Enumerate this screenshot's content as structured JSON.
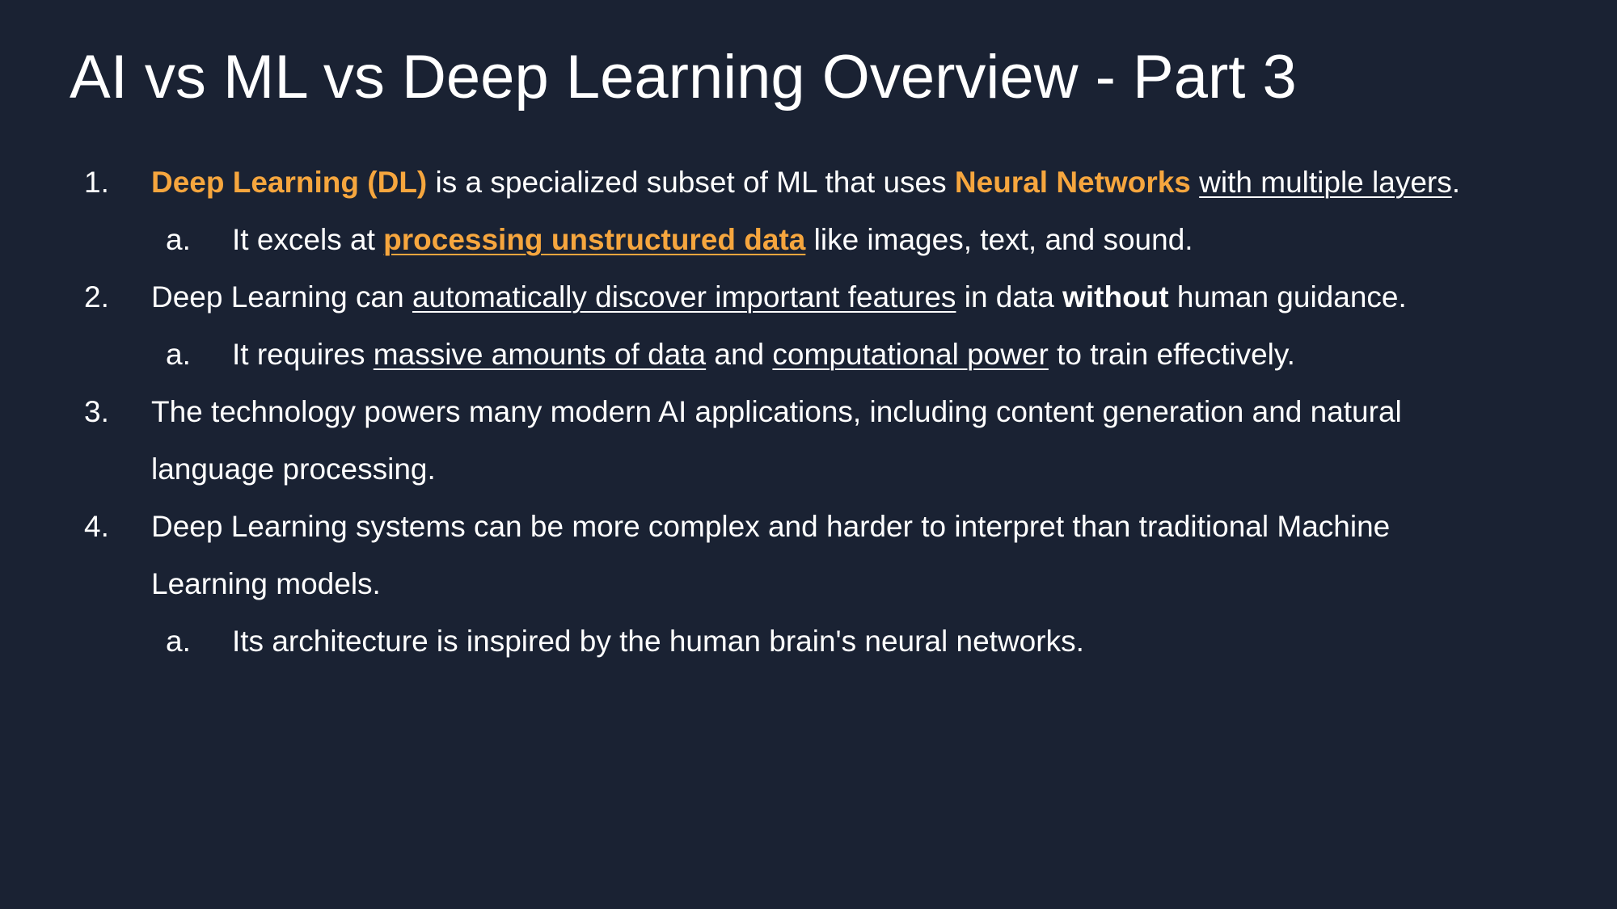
{
  "slide": {
    "title": "AI vs ML vs Deep Learning Overview - Part 3",
    "accent_color": "#f6a63e",
    "background_color": "#1a2233"
  },
  "items": {
    "i1": {
      "marker": "1.",
      "s1": "Deep Learning (DL)",
      "s2": " is a specialized subset of ML that uses ",
      "s3": "Neural Networks",
      "s4": " ",
      "s5": "with multiple layers",
      "s6": "."
    },
    "i1a": {
      "marker": "a.",
      "s1": "It excels at ",
      "s2": "processing unstructured data",
      "s3": " like images, text, and sound."
    },
    "i2": {
      "marker": "2.",
      "s1": "Deep Learning can ",
      "s2": "automatically discover important features",
      "s3": " in data ",
      "s4": "without",
      "s5": " human guidance."
    },
    "i2a": {
      "marker": "a.",
      "s1": "It requires ",
      "s2": "massive amounts of data",
      "s3": " and ",
      "s4": "computational power",
      "s5": " to train effectively."
    },
    "i3": {
      "marker": "3.",
      "line1": "The technology powers many modern AI applications, including content generation and natural",
      "line2": "language processing."
    },
    "i4": {
      "marker": "4.",
      "line1": "Deep Learning systems can be more complex and harder to interpret than traditional Machine",
      "line2": "Learning models."
    },
    "i4a": {
      "marker": "a.",
      "s1": "Its architecture is inspired by the human brain's neural networks."
    }
  }
}
